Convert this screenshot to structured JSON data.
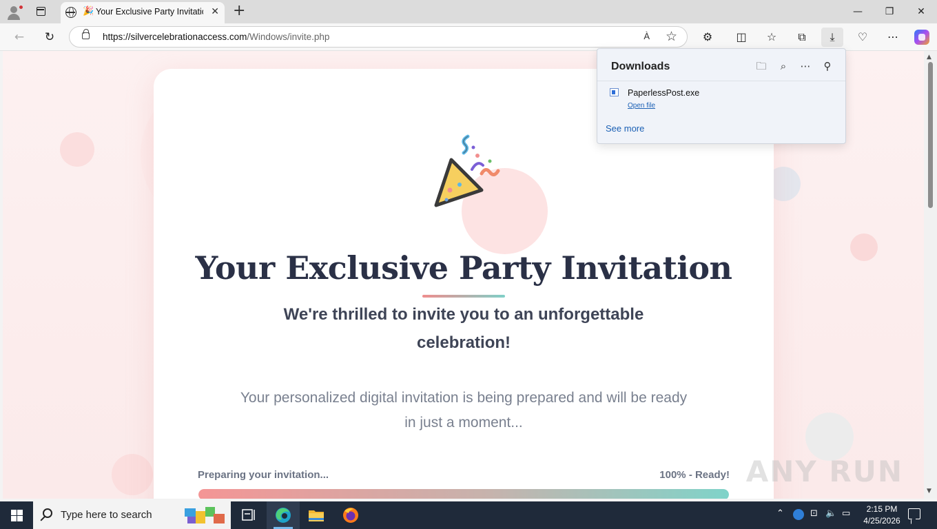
{
  "browser": {
    "tab_title": "Your Exclusive Party Invitation",
    "tab_favicon": "🎉",
    "url_host": "https://silvercelebrationaccess.com",
    "url_path": "/Windows/invite.php",
    "read_aloud_label": "À",
    "window_controls": {
      "minimize": "—",
      "restore": "❐",
      "close": "✕"
    },
    "toolbar_icons": [
      "extensions-icon",
      "split-screen-icon",
      "favorites-icon",
      "collections-icon",
      "downloads-icon",
      "browser-essentials-icon",
      "more-icon",
      "copilot-icon"
    ]
  },
  "downloads_panel": {
    "title": "Downloads",
    "file_name": "PaperlessPost.exe",
    "open_file_label": "Open file",
    "see_more_label": "See more"
  },
  "page": {
    "heading": "Your Exclusive Party Invitation",
    "subheading": "We're thrilled to invite you to an unforgettable celebration!",
    "lead": "Your personalized digital invitation is being prepared and will be ready in just a moment...",
    "progress_label": "Preparing your invitation...",
    "progress_status": "100% - Ready!",
    "progress_value": 1.0,
    "accent_gradient": [
      "#f49595",
      "#7fd3c9"
    ],
    "heading_color": "#2a3046"
  },
  "watermark": "ANY RUN",
  "taskbar": {
    "search_placeholder": "Type here to search",
    "apps": [
      "task-view-icon",
      "edge-icon",
      "file-explorer-icon",
      "firefox-icon"
    ],
    "time": "2:15 PM",
    "date": "4/25/2026"
  }
}
